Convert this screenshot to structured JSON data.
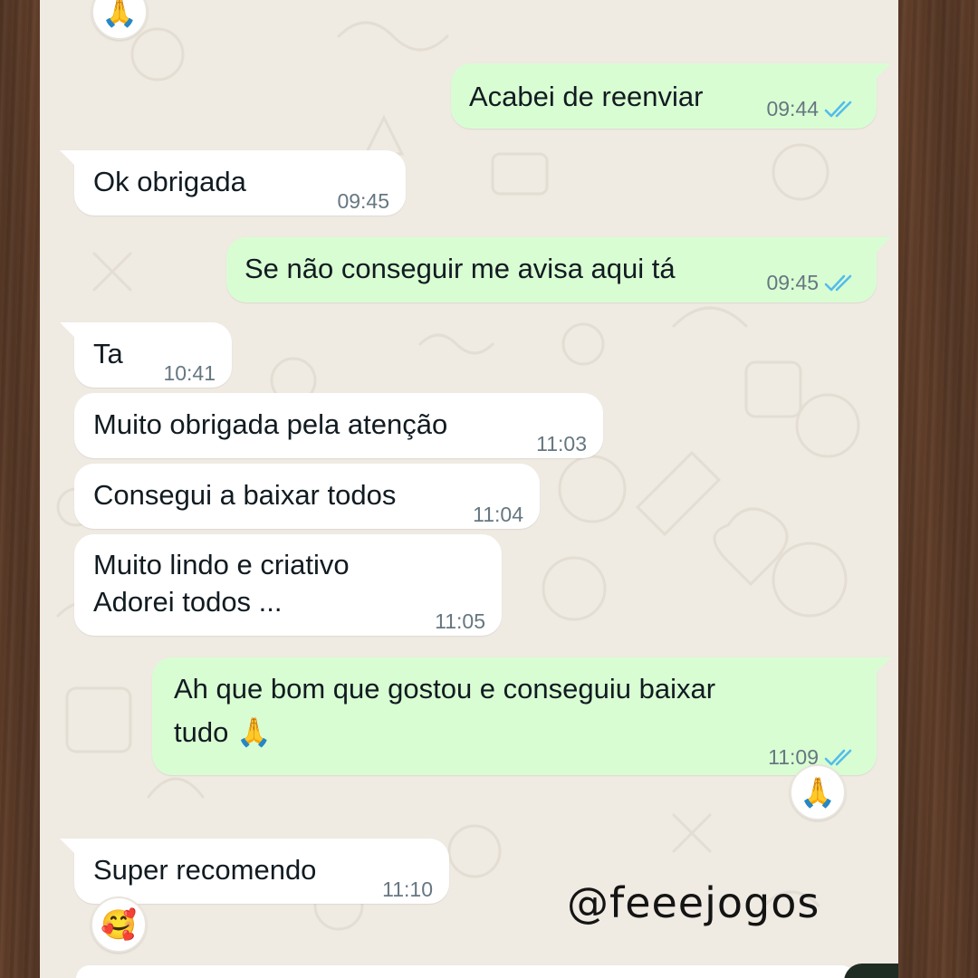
{
  "watermark": "@feeejogos",
  "colors": {
    "incoming_bubble": "#ffffff",
    "outgoing_bubble": "#d9fdd3",
    "chat_background": "#efeae2",
    "read_ticks": "#53bdeb",
    "timestamp": "#667781"
  },
  "messages": [
    {
      "direction": "outgoing",
      "lines": [
        "Acabei de reenviar"
      ],
      "time": "09:44",
      "status": "read"
    },
    {
      "direction": "incoming",
      "lines": [
        "Ok obrigada"
      ],
      "time": "09:45"
    },
    {
      "direction": "outgoing",
      "lines": [
        "Se não conseguir me avisa aqui tá"
      ],
      "time": "09:45",
      "status": "read"
    },
    {
      "direction": "incoming",
      "lines": [
        "Ta"
      ],
      "time": "10:41"
    },
    {
      "direction": "incoming",
      "lines": [
        "Muito obrigada pela atenção"
      ],
      "time": "11:03"
    },
    {
      "direction": "incoming",
      "lines": [
        "Consegui a baixar todos"
      ],
      "time": "11:04"
    },
    {
      "direction": "incoming",
      "lines": [
        "Muito lindo e criativo",
        "Adorei todos ..."
      ],
      "time": "11:05"
    },
    {
      "direction": "outgoing",
      "lines": [
        "Ah que bom que gostou e conseguiu baixar",
        "tudo 🙏"
      ],
      "time": "11:09",
      "status": "read",
      "reaction": "🙏"
    },
    {
      "direction": "incoming",
      "lines": [
        "Super recomendo"
      ],
      "time": "11:10",
      "reaction": "🥰"
    }
  ],
  "top_reaction": "🙏"
}
